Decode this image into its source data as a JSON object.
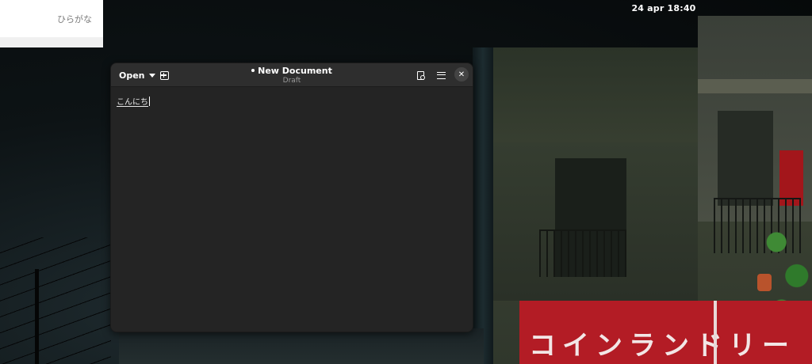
{
  "topbar": {
    "clock": "24 apr  18:40"
  },
  "ime_popup": {
    "label": "ひらがな"
  },
  "window": {
    "title": "New Document",
    "subtitle": "Draft",
    "open_label": "Open",
    "close_glyph": "✕",
    "icons": [
      "chevron-down-icon",
      "new-tab-icon",
      "search-document-icon",
      "hamburger-menu-icon",
      "close-icon"
    ],
    "unsaved_indicator": "•"
  },
  "editor": {
    "text": "こんにち"
  },
  "wallpaper": {
    "sign_text": "コインランドリー",
    "colors": {
      "sign_red": "#b31c25",
      "window_bg": "#242424",
      "headerbar_bg": "#2e2e2e"
    }
  }
}
